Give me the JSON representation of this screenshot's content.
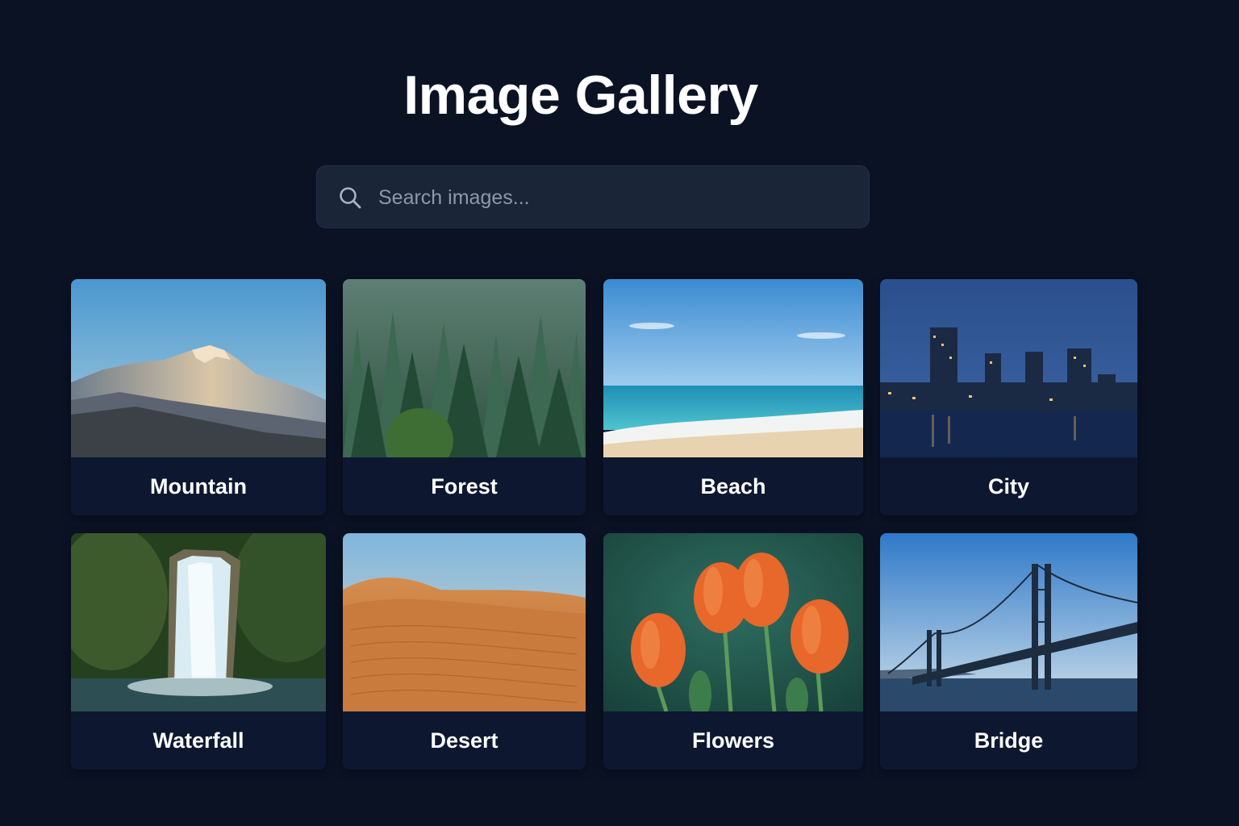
{
  "header": {
    "title": "Image Gallery"
  },
  "search": {
    "placeholder": "Search images...",
    "value": "",
    "icon": "search-icon"
  },
  "gallery": {
    "items": [
      {
        "label": "Mountain"
      },
      {
        "label": "Forest"
      },
      {
        "label": "Beach"
      },
      {
        "label": "City"
      },
      {
        "label": "Waterfall"
      },
      {
        "label": "Desert"
      },
      {
        "label": "Flowers"
      },
      {
        "label": "Bridge"
      }
    ]
  },
  "colors": {
    "background": "#0a1224",
    "search_background": "#1a2538",
    "card_background": "#0d1830",
    "title_text": "#ffffff"
  }
}
